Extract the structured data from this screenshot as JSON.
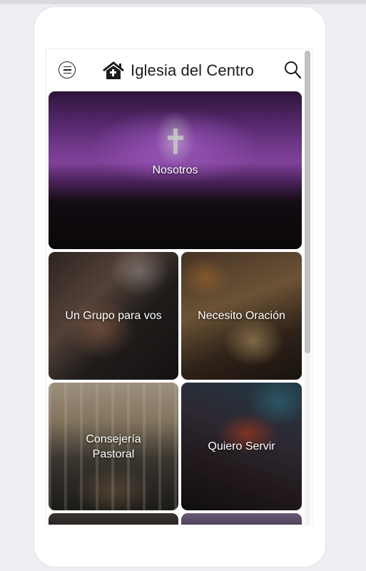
{
  "app": {
    "title": "Iglesia del Centro"
  },
  "header": {
    "menu_icon": "menu-circle-icon",
    "logo_icon": "church-roof-logo",
    "search_icon": "search-icon"
  },
  "tiles": [
    {
      "label": "Nosotros"
    },
    {
      "label": "Un Grupo para vos"
    },
    {
      "label": "Necesito Oración"
    },
    {
      "label": "Consejería Pastoral"
    },
    {
      "label": "Quiero Servir"
    }
  ],
  "colors": {
    "background": "#eceef1",
    "phone": "#ffffff",
    "text": "#1c1c1c"
  }
}
